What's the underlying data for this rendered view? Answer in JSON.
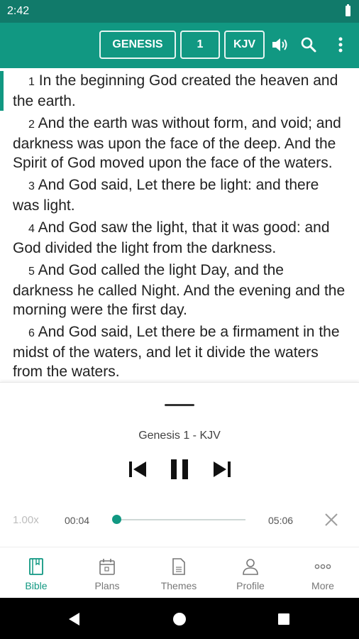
{
  "status_bar": {
    "time": "2:42"
  },
  "toolbar": {
    "book": "GENESIS",
    "chapter": "1",
    "version": "KJV",
    "icons": [
      "speaker-icon",
      "search-icon",
      "more-vertical-icon"
    ]
  },
  "verses": [
    {
      "num": "1",
      "text": "In the beginning God created the heaven and the earth."
    },
    {
      "num": "2",
      "text": "And the earth was without form, and void; and darkness was upon the face of the deep. And the Spirit of God moved upon the face of the waters."
    },
    {
      "num": "3",
      "text": "And God said, Let there be light: and there was light."
    },
    {
      "num": "4",
      "text": "And God saw the light, that it was good: and God divided the light from the darkness."
    },
    {
      "num": "5",
      "text": "And God called the light Day, and the darkness he called Night. And the evening and the morning were the first day."
    },
    {
      "num": "6",
      "text": "And God said, Let there be a firmament in the midst of the waters, and let it divide the waters from the waters."
    }
  ],
  "player": {
    "title": "Genesis 1 - KJV",
    "speed": "1.00x",
    "elapsed": "00:04",
    "total": "05:06",
    "progress": 0.013,
    "state": "playing"
  },
  "bottom_nav": [
    {
      "label": "Bible",
      "icon": "bible-book-icon",
      "active": true
    },
    {
      "label": "Plans",
      "icon": "calendar-icon",
      "active": false
    },
    {
      "label": "Themes",
      "icon": "document-icon",
      "active": false
    },
    {
      "label": "Profile",
      "icon": "person-icon",
      "active": false
    },
    {
      "label": "More",
      "icon": "more-horizontal-icon",
      "active": false
    }
  ],
  "colors": {
    "primary": "#119882",
    "status_bar": "#117a6a",
    "accent": "#119882"
  }
}
